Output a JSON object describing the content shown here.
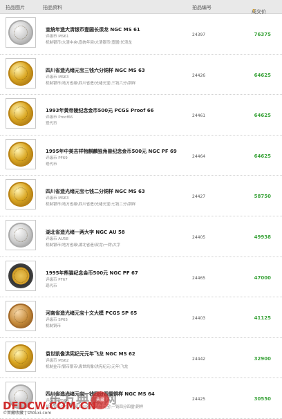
{
  "header": {
    "image_col": "拍品图片",
    "info_col": "拍品资料",
    "lot_col": "拍品编号",
    "price_col": "成交价",
    "sort_icon": "↑"
  },
  "lots": [
    {
      "title": "宣统年造大清银币壹圆长须龙 NGC MS 61",
      "sub1": "评级币 MS61",
      "sub2": "机制银币\\大清中央\\宣统年间\\大清银币\\壹圆\\长须龙",
      "lot": "24397",
      "price": "76375",
      "coin": "silver"
    },
    {
      "title": "四川省造光绪元宝三钱六分铜样 NGC MS 63",
      "sub1": "评级币 MS63",
      "sub2": "机制银币\\地方省级\\四川省造\\光绪元宝\\三钱六分\\铜样",
      "lot": "24426",
      "price": "64625",
      "coin": "gold"
    },
    {
      "title": "1993年黄帝陵纪念金币500元 PCGS Proof 66",
      "sub1": "评级币 Proof66",
      "sub2": "现代币",
      "lot": "24461",
      "price": "64625",
      "coin": "gold"
    },
    {
      "title": "1995年中美吉祥物麒麟独角兽纪念金币500元 NGC PF 69",
      "sub1": "评级币 PF69",
      "sub2": "现代币",
      "lot": "24464",
      "price": "64625",
      "coin": "gold"
    },
    {
      "title": "四川省造光绪元宝七钱二分铜样 NGC MS 63",
      "sub1": "评级币 MS63",
      "sub2": "机制银币\\地方省级\\四川省造\\光绪元宝\\七钱二分\\铜样",
      "lot": "24427",
      "price": "58750",
      "coin": "gold"
    },
    {
      "title": "湖北省造光绪一两大字 NGC AU 58",
      "sub1": "评级币 AU58",
      "sub2": "机制银币\\地方省级\\湖北省造\\双龙\\一两\\大字",
      "lot": "24405",
      "price": "49938",
      "coin": "silver"
    },
    {
      "title": "1995年熊猫纪念金币500元 NGC PF 67",
      "sub1": "评级币 PF67",
      "sub2": "现代币",
      "lot": "24465",
      "price": "47000",
      "coin": "bimetal"
    },
    {
      "title": "河南省造光绪元宝十文大模 PCGS SP 65",
      "sub1": "评级币 SP65",
      "sub2": "机制铜币",
      "lot": "24403",
      "price": "41125",
      "coin": "copper"
    },
    {
      "title": "袁世凯像洪宪纪元元年飞龙 NGC MS 62",
      "sub1": "评级币 MS62",
      "sub2": "机制金币\\银币银币\\袁世凯像\\洪宪纪元\\元年\\飞龙",
      "lot": "24442",
      "price": "32900",
      "coin": "gold"
    },
    {
      "title": "四川省造光绪元宝一钱四分四厘铜样 NGC MS 64",
      "sub1": "评级币 MS64",
      "sub2": "机制银币\\地方省级\\四川省造\\光绪元宝\\一钱四分四厘\\铜样",
      "lot": "24425",
      "price": "30550",
      "coin": "silver"
    }
  ],
  "watermark": {
    "brand": "东方典藏网",
    "seal_text": "典藏",
    "site": "DFDCW.COM.CN",
    "credit": "©首藏收藏 | shouxi.com"
  },
  "colors": {
    "header_bg": "#e9e9e9",
    "price_green": "#3aa33a",
    "watermark_red": "#d12a2a"
  }
}
